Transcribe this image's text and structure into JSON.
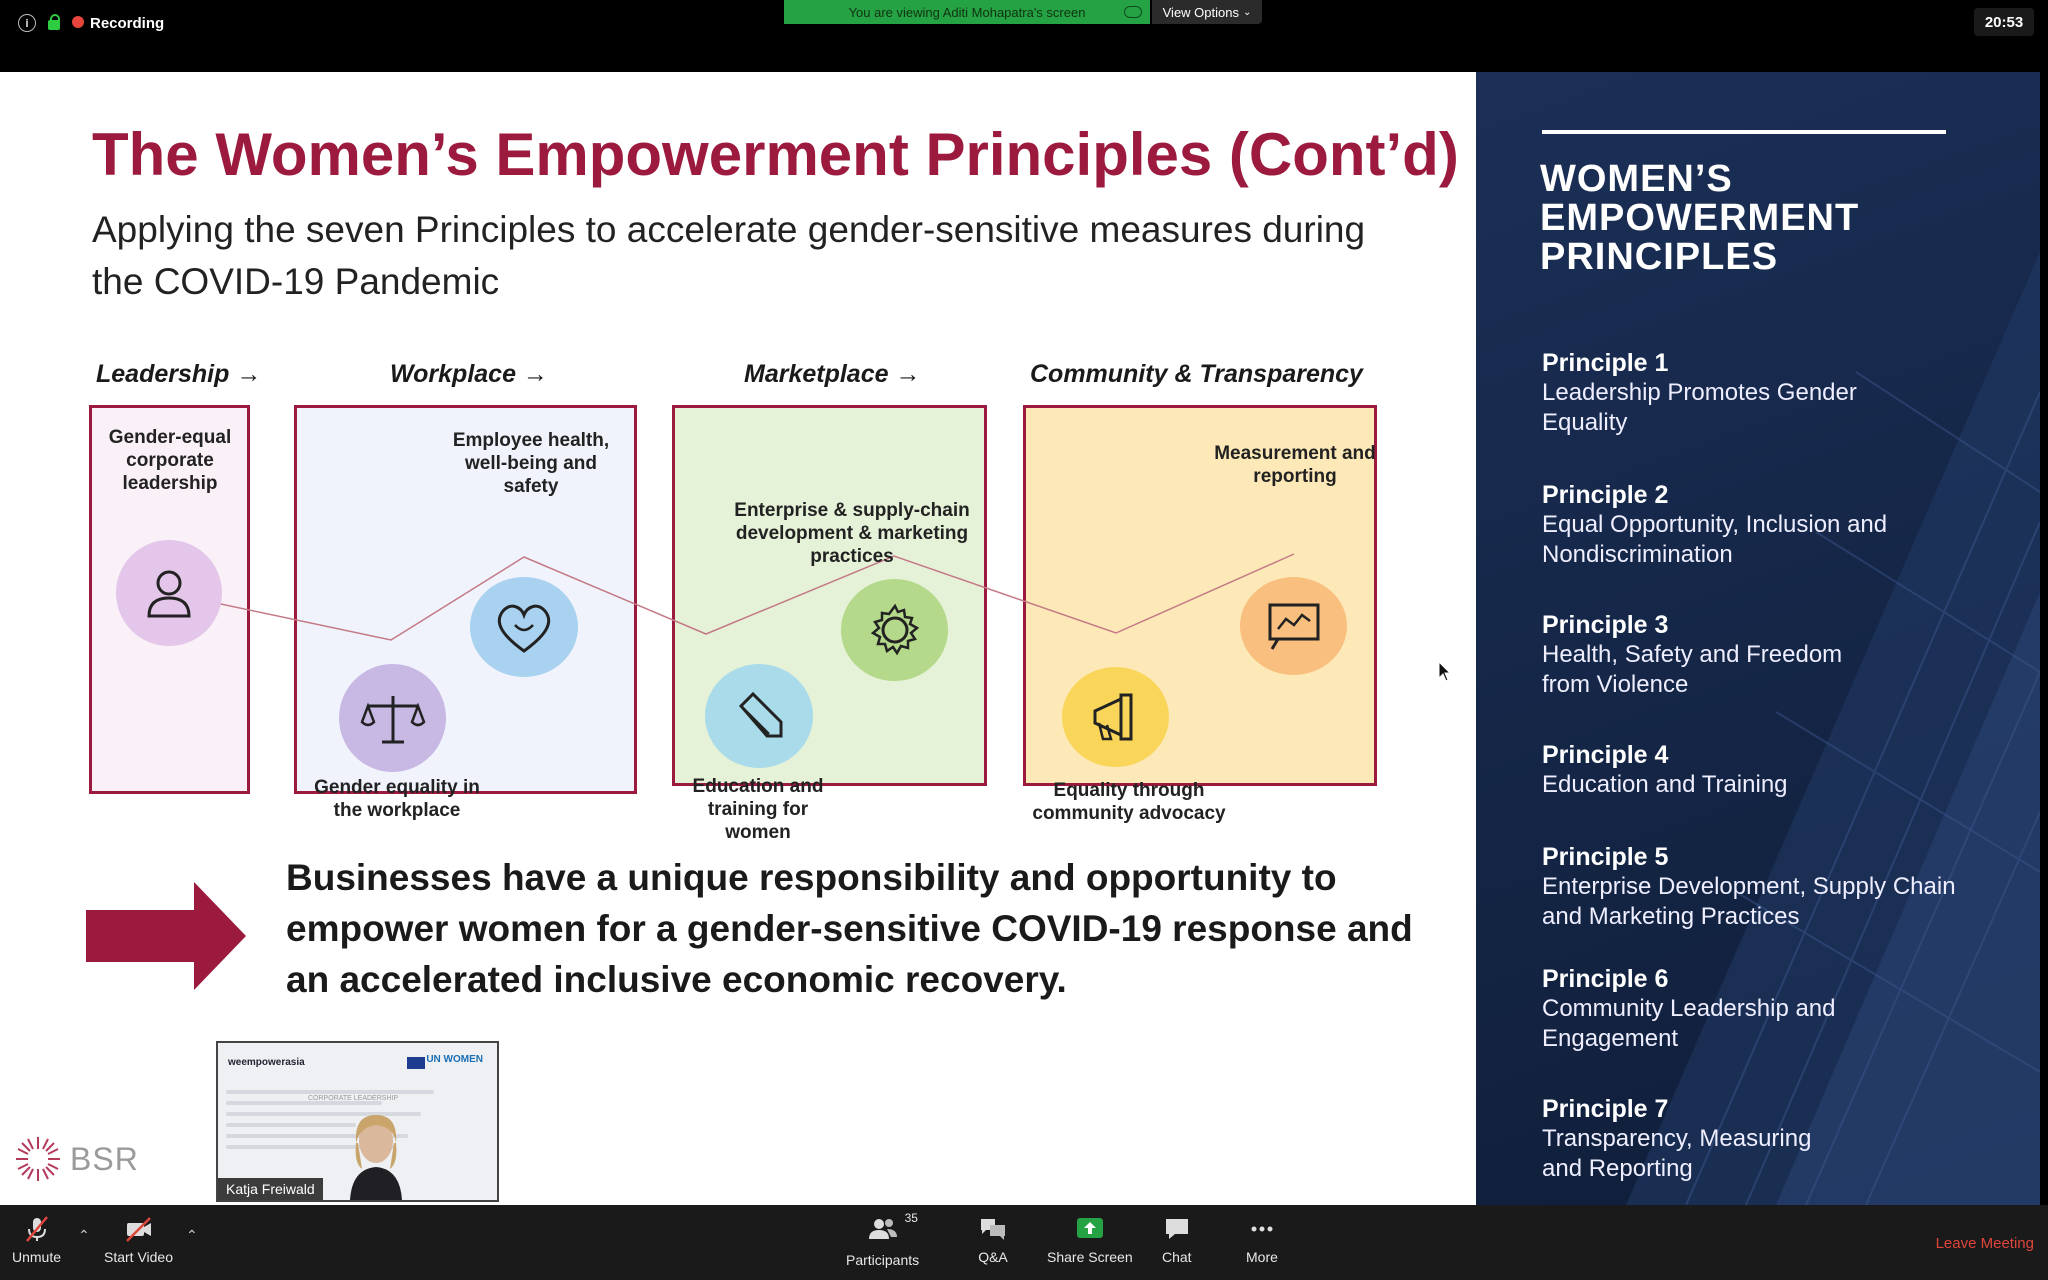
{
  "topbar": {
    "recording_label": "Recording",
    "viewing_banner": "You are viewing Aditi Mohapatra's screen",
    "view_options_label": "View Options",
    "clock": "20:53"
  },
  "slide": {
    "title": "The Women’s Empowerment Principles (Cont’d)",
    "subtitle": "Applying the seven Principles to accelerate gender-sensitive measures during the COVID-19 Pandemic",
    "categories": {
      "leadership": "Leadership →",
      "workplace": "Workplace →",
      "marketplace": "Marketplace →",
      "community": "Community & Transparency"
    },
    "nodes": {
      "leadership": "Gender-equal corporate leadership",
      "workplace_equality": "Gender equality in the workplace",
      "health": "Employee health, well-being and safety",
      "education": "Education and training for women",
      "enterprise": "Enterprise & supply-chain development & marketing practices",
      "community_advocacy": "Equality through community advocacy",
      "measurement": "Measurement and reporting"
    },
    "callout": "Businesses have a unique responsibility and opportunity to empower women for a gender-sensitive COVID-19 response and an accelerated inclusive economic recovery.",
    "logo_text": "BSR",
    "accent_color": "#9b1a3e"
  },
  "video_thumb": {
    "participant_name": "Katja Freiwald",
    "brand_text": "weempowerasia",
    "partner_text": "UN WOMEN",
    "caption_text": "CORPORATE LEADERSHIP"
  },
  "panel": {
    "title": "WOMEN’S EMPOWERMENT PRINCIPLES",
    "principles": [
      {
        "heading": "Principle 1",
        "text": "Leadership Promotes Gender Equality"
      },
      {
        "heading": "Principle 2",
        "text": "Equal Opportunity, Inclusion and Nondiscrimination"
      },
      {
        "heading": "Principle 3",
        "text": "Health, Safety and Freedom from Violence"
      },
      {
        "heading": "Principle 4",
        "text": "Education and Training"
      },
      {
        "heading": "Principle 5",
        "text": "Enterprise Development, Supply Chain and Marketing Practices"
      },
      {
        "heading": "Principle 6",
        "text": "Community Leadership and Engagement"
      },
      {
        "heading": "Principle 7",
        "text": "Transparency, Measuring and Reporting"
      }
    ]
  },
  "toolbar": {
    "unmute": "Unmute",
    "start_video": "Start Video",
    "participants": "Participants",
    "participants_count": "35",
    "qa": "Q&A",
    "share_screen": "Share Screen",
    "chat": "Chat",
    "more": "More",
    "leave": "Leave Meeting"
  }
}
